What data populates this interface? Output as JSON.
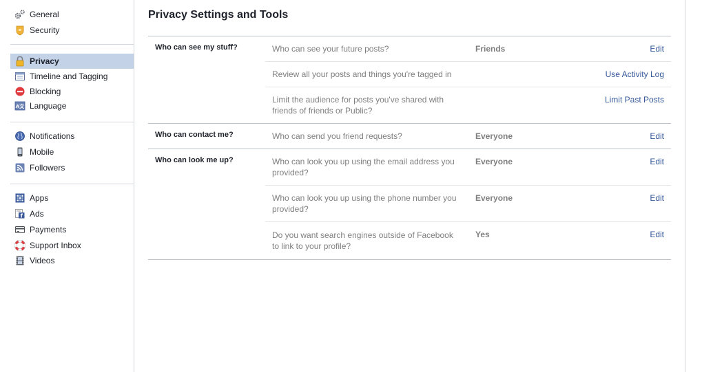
{
  "sidebar": {
    "groups": [
      [
        {
          "label": "General",
          "icon": "gears-icon"
        },
        {
          "label": "Security",
          "icon": "security-badge-icon"
        }
      ],
      [
        {
          "label": "Privacy",
          "icon": "padlock-icon",
          "selected": true
        },
        {
          "label": "Timeline and Tagging",
          "icon": "timeline-icon"
        },
        {
          "label": "Blocking",
          "icon": "blocking-icon"
        },
        {
          "label": "Language",
          "icon": "language-icon"
        }
      ],
      [
        {
          "label": "Notifications",
          "icon": "globe-icon"
        },
        {
          "label": "Mobile",
          "icon": "mobile-phone-icon"
        },
        {
          "label": "Followers",
          "icon": "rss-feed-icon"
        }
      ],
      [
        {
          "label": "Apps",
          "icon": "apps-grid-icon"
        },
        {
          "label": "Ads",
          "icon": "ads-icon"
        },
        {
          "label": "Payments",
          "icon": "credit-card-icon"
        },
        {
          "label": "Support Inbox",
          "icon": "lifebuoy-icon"
        },
        {
          "label": "Videos",
          "icon": "film-strip-icon"
        }
      ]
    ]
  },
  "main": {
    "title": "Privacy Settings and Tools",
    "sections": [
      {
        "title": "Who can see my stuff?",
        "rows": [
          {
            "question": "Who can see your future posts?",
            "value": "Friends",
            "action": "Edit"
          },
          {
            "question": "Review all your posts and things you're tagged in",
            "value": "",
            "action": "Use Activity Log"
          },
          {
            "question": "Limit the audience for posts you've shared with friends of friends or Public?",
            "value": "",
            "action": "Limit Past Posts"
          }
        ]
      },
      {
        "title": "Who can contact me?",
        "rows": [
          {
            "question": "Who can send you friend requests?",
            "value": "Everyone",
            "action": "Edit"
          }
        ]
      },
      {
        "title": "Who can look me up?",
        "rows": [
          {
            "question": "Who can look you up using the email address you provided?",
            "value": "Everyone",
            "action": "Edit"
          },
          {
            "question": "Who can look you up using the phone number you provided?",
            "value": "Everyone",
            "action": "Edit"
          },
          {
            "question": "Do you want search engines outside of Facebook to link to your profile?",
            "value": "Yes",
            "action": "Edit"
          }
        ]
      }
    ]
  },
  "colors": {
    "link": "#365899",
    "selected_bg": "#c4d2e7",
    "muted_text": "#7f7f7f",
    "border": "#bdc1c9"
  }
}
